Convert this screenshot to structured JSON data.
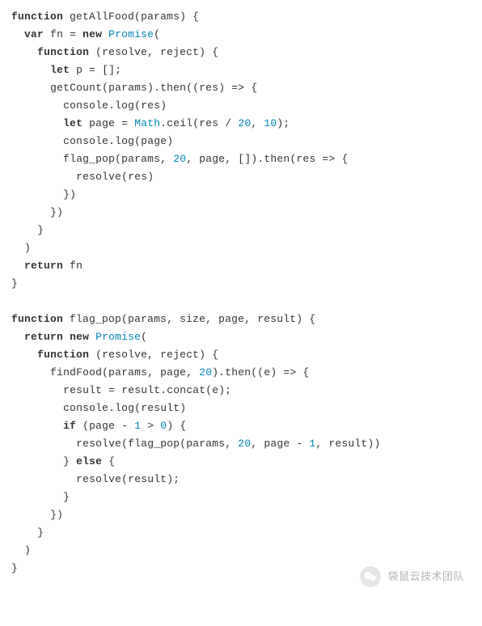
{
  "code": {
    "lines": [
      "function getAllFood(params) {",
      "  var fn = new Promise(",
      "    function (resolve, reject) {",
      "      let p = [];",
      "      getCount(params).then((res) => {",
      "        console.log(res)",
      "        let page = Math.ceil(res / 20, 10);",
      "        console.log(page)",
      "        flag_pop(params, 20, page, []).then(res => {",
      "          resolve(res)",
      "        })",
      "      })",
      "    }",
      "  )",
      "  return fn",
      "}",
      "",
      "function flag_pop(params, size, page, result) {",
      "  return new Promise(",
      "    function (resolve, reject) {",
      "      findFood(params, page, 20).then((e) => {",
      "        result = result.concat(e);",
      "        console.log(result)",
      "        if (page - 1 > 0) {",
      "          resolve(flag_pop(params, 20, page - 1, result))",
      "        } else {",
      "          resolve(result);",
      "        }",
      "      })",
      "    }",
      "  )",
      "}"
    ]
  },
  "watermark": {
    "text": "袋鼠云技术团队",
    "icon_name": "wechat-icon"
  },
  "syntax": {
    "keywords": [
      "function",
      "var",
      "new",
      "let",
      "return",
      "if",
      "else"
    ],
    "types": [
      "Promise",
      "Math"
    ],
    "numbers": [
      "20",
      "10",
      "1",
      "0"
    ]
  }
}
